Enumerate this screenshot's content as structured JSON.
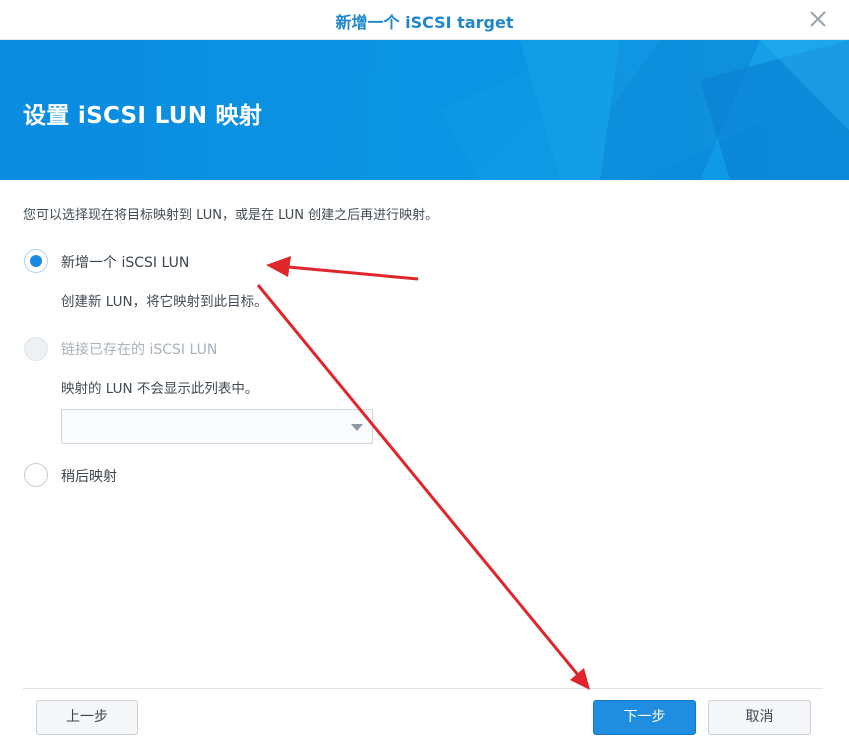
{
  "window": {
    "title": "新增一个 iSCSI target"
  },
  "banner": {
    "heading": "设置 iSCSI LUN 映射"
  },
  "content": {
    "description": "您可以选择现在将目标映射到 LUN，或是在 LUN 创建之后再进行映射。",
    "options": [
      {
        "label": "新增一个 iSCSI LUN",
        "sub": "创建新 LUN，将它映射到此目标。",
        "checked": true,
        "disabled": false
      },
      {
        "label": "链接已存在的 iSCSI LUN",
        "sub": "映射的 LUN 不会显示此列表中。",
        "checked": false,
        "disabled": true
      },
      {
        "label": "稍后映射",
        "checked": false,
        "disabled": false
      }
    ],
    "existing_lun_select": {
      "value": ""
    }
  },
  "footer": {
    "back_label": "上一步",
    "next_label": "下一步",
    "cancel_label": "取消"
  },
  "colors": {
    "accent": "#1f8de0",
    "annotation_arrow": "#e0262b"
  },
  "icons": {
    "close": "close-icon",
    "dropdown": "chevron-down-icon"
  }
}
